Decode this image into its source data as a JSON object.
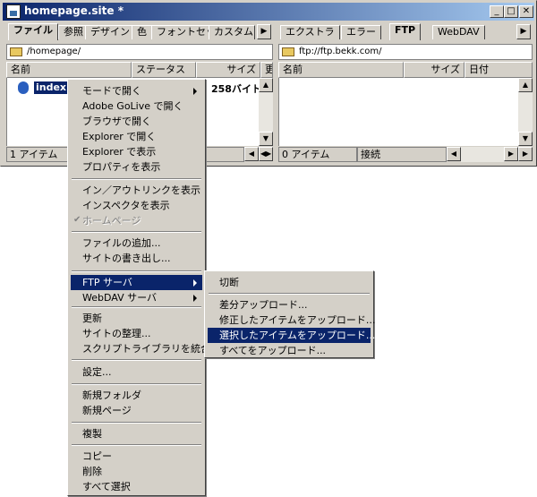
{
  "window": {
    "title": "homepage.site *",
    "btn_min": "_",
    "btn_max": "□",
    "btn_close": "✕"
  },
  "left_pane": {
    "tabs": [
      "ファイル",
      "参照",
      "デザイン",
      "色",
      "フォントセット",
      "カスタム"
    ],
    "tab_arrow": "▶",
    "path": "/homepage/",
    "columns": [
      "名前",
      "ステータス",
      "サイズ",
      "更"
    ],
    "items": [
      {
        "name": "index.html",
        "size": "258バイト"
      }
    ],
    "status_count": "1 アイテム"
  },
  "right_pane": {
    "tabs": [
      "エクストラ",
      "エラー",
      "FTP",
      "WebDAV"
    ],
    "tab_arrow": "▶",
    "path": "ftp://ftp.bekk.com/",
    "columns": [
      "名前",
      "サイズ",
      "日付"
    ],
    "status_count": "0 アイテム",
    "status_conn": "接続"
  },
  "context_menu": {
    "items": [
      {
        "label": "モードで開く",
        "submenu": true
      },
      {
        "label": "Adobe GoLive で開く"
      },
      {
        "label": "ブラウザで開く"
      },
      {
        "label": "Explorer で開く"
      },
      {
        "label": "Explorer で表示"
      },
      {
        "label": "プロパティを表示"
      },
      {
        "label": "イン／アウトリンクを表示"
      },
      {
        "label": "インスペクタを表示"
      },
      {
        "label": "ホームページ",
        "disabled": true,
        "checked": true
      },
      {
        "label": "ファイルの追加..."
      },
      {
        "label": "サイトの書き出し..."
      },
      {
        "label": "FTP サーバ",
        "submenu": true,
        "highlighted": true
      },
      {
        "label": "WebDAV サーバ",
        "submenu": true
      },
      {
        "label": "更新"
      },
      {
        "label": "サイトの整理..."
      },
      {
        "label": "スクリプトライブラリを統合"
      },
      {
        "label": "設定..."
      },
      {
        "label": "新規フォルダ"
      },
      {
        "label": "新規ページ"
      },
      {
        "label": "複製"
      },
      {
        "label": "コピー"
      },
      {
        "label": "削除"
      },
      {
        "label": "すべて選択"
      }
    ],
    "check_glyph": "✔"
  },
  "ftp_submenu": {
    "items": [
      {
        "label": "切断"
      },
      {
        "label": "差分アップロード..."
      },
      {
        "label": "修正したアイテムをアップロード..."
      },
      {
        "label": "選択したアイテムをアップロード...",
        "highlighted": true
      },
      {
        "label": "すべてをアップロード..."
      }
    ]
  }
}
